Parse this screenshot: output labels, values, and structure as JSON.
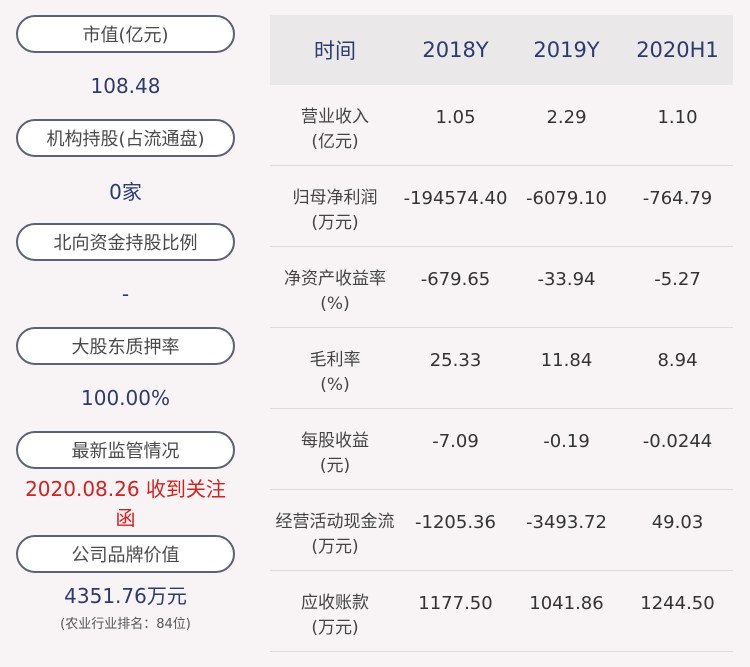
{
  "left": [
    {
      "label": "市值(亿元)",
      "value": "108.48",
      "note": ""
    },
    {
      "label": "机构持股(占流通盘)",
      "value": "0家",
      "note": ""
    },
    {
      "label": "北向资金持股比例",
      "value": "-",
      "note": ""
    },
    {
      "label": "大股东质押率",
      "value": "100.00%",
      "note": ""
    },
    {
      "label": "最新监管情况",
      "value": "2020.08.26 收到关注函",
      "note": ""
    },
    {
      "label": "公司品牌价值",
      "value": "4351.76万元",
      "note": "(农业行业排名：84位)"
    }
  ],
  "table": {
    "headers": [
      "时间",
      "2018Y",
      "2019Y",
      "2020H1"
    ],
    "rows": [
      {
        "label1": "营业收入",
        "label2": "(亿元)",
        "v": [
          "1.05",
          "2.29",
          "1.10"
        ]
      },
      {
        "label1": "归母净利润",
        "label2": "(万元)",
        "v": [
          "-194574.40",
          "-6079.10",
          "-764.79"
        ]
      },
      {
        "label1": "净资产收益率",
        "label2": "(%)",
        "v": [
          "-679.65",
          "-33.94",
          "-5.27"
        ]
      },
      {
        "label1": "毛利率",
        "label2": "(%)",
        "v": [
          "25.33",
          "11.84",
          "8.94"
        ]
      },
      {
        "label1": "每股收益",
        "label2": "(元)",
        "v": [
          "-7.09",
          "-0.19",
          "-0.0244"
        ]
      },
      {
        "label1": "经营活动现金流",
        "label2": "(万元)",
        "v": [
          "-1205.36",
          "-3493.72",
          "49.03"
        ]
      },
      {
        "label1": "应收账款",
        "label2": "(万元)",
        "v": [
          "1177.50",
          "1041.86",
          "1244.50"
        ]
      }
    ]
  },
  "colors": {
    "value_blue": "#2c3a6e",
    "alert_red": "#d42020",
    "header_bg": "#ebe8ea",
    "page_bg": "#f8f4f6"
  }
}
